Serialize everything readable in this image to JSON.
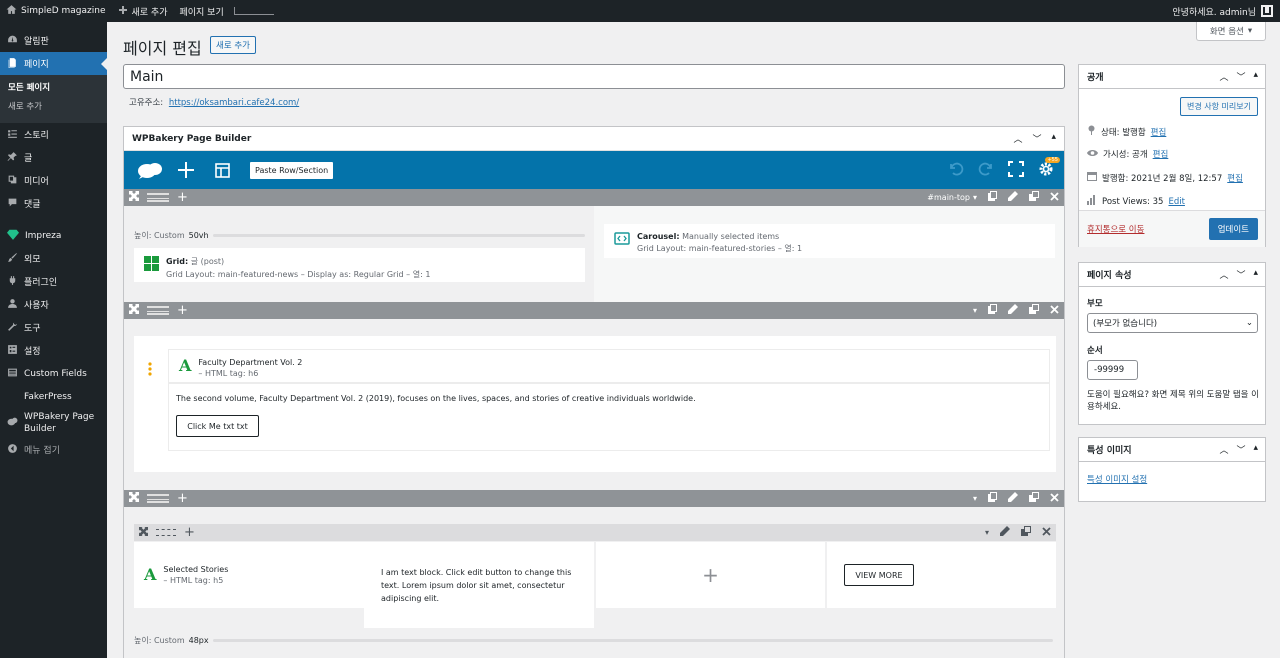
{
  "admin_bar": {
    "site_name": "SimpleD magazine",
    "new_label": "새로 추가",
    "view_page": "페이지 보기",
    "greeting": "안녕하세요. admin님"
  },
  "sidebar": {
    "items": [
      {
        "label": "알림판",
        "icon": "dashboard-icon"
      },
      {
        "label": "페이지",
        "icon": "pages-icon"
      },
      {
        "label": "스토리",
        "icon": "stories-icon"
      },
      {
        "label": "글",
        "icon": "pin-icon"
      },
      {
        "label": "미디어",
        "icon": "media-icon"
      },
      {
        "label": "댓글",
        "icon": "comments-icon"
      },
      {
        "label": "Impreza",
        "icon": "diamond-icon"
      },
      {
        "label": "외모",
        "icon": "brush-icon"
      },
      {
        "label": "플러그인",
        "icon": "plugin-icon"
      },
      {
        "label": "사용자",
        "icon": "users-icon"
      },
      {
        "label": "도구",
        "icon": "tools-icon"
      },
      {
        "label": "설정",
        "icon": "settings-icon"
      },
      {
        "label": "Custom Fields",
        "icon": "fields-icon"
      },
      {
        "label": "FakerPress",
        "icon": ""
      },
      {
        "label": "WPBakery Page Builder",
        "icon": "wpbakery-icon"
      },
      {
        "label": "메뉴 접기",
        "icon": "collapse-icon"
      }
    ],
    "submenu": [
      "모든 페이지",
      "새로 추가"
    ]
  },
  "header": {
    "screen_options": "화면 옵션",
    "title": "페이지 편집",
    "add_new": "새로 추가",
    "post_title": "Main",
    "permalink_label": "고유주소:",
    "permalink_url": "https://oksambari.cafe24.com/"
  },
  "builder": {
    "title": "WPBakery Page Builder",
    "paste_tooltip": "Paste Row/Section",
    "badge": "+55",
    "row1": {
      "label": "#main-top",
      "height_label": "높이: Custom",
      "height_value": "50vh",
      "grid_title": "Grid:",
      "grid_type": "글 (post)",
      "grid_desc": "Grid Layout: main-featured-news – Display as: Regular Grid – 열: 1",
      "carousel_title": "Carousel:",
      "carousel_type": "Manually selected items",
      "carousel_desc": "Grid Layout: main-featured-stories – 열: 1"
    },
    "row2": {
      "heading_title": "Faculty Department Vol. 2",
      "heading_tag": "– HTML tag: h6",
      "paragraph": "The second volume, Faculty Department Vol. 2 (2019), focuses on the lives, spaces, and stories of creative individuals worldwide.",
      "button": "Click Me txt txt"
    },
    "row3": {
      "heading_title": "Selected Stories",
      "heading_tag": "– HTML tag: h5",
      "text_block": "I am text block. Click edit button to change this text. Lorem ipsum dolor sit amet, consectetur adipiscing elit.",
      "button": "VIEW MORE",
      "height_label": "높이: Custom",
      "height_value": "48px"
    }
  },
  "publish_box": {
    "title": "공개",
    "preview_button": "변경 사항 미리보기",
    "status_label": "상태: 발행함",
    "visibility_label": "가시성: 공개",
    "published_label": "발행함: 2021년 2월 8일, 12:57",
    "edit": "편집",
    "views_label": "Post Views: 35",
    "views_edit": "Edit",
    "trash": "휴지통으로 이동",
    "update": "업데이트"
  },
  "attributes_box": {
    "title": "페이지 속성",
    "parent_label": "부모",
    "parent_value": "(부모가 없습니다)",
    "order_label": "순서",
    "order_value": "-99999",
    "help": "도움이 필요해요? 화면 제목 위의 도움말 탭을 이용하세요."
  },
  "featured_box": {
    "title": "특성 이미지",
    "set_link": "특성 이미지 설정"
  },
  "colors": {
    "admin_dark": "#1d2327",
    "wp_blue": "#2271b1",
    "wpbakery_blue": "#0473aa",
    "row_bar": "#8f9397",
    "accent_green": "#1a9a3c"
  }
}
